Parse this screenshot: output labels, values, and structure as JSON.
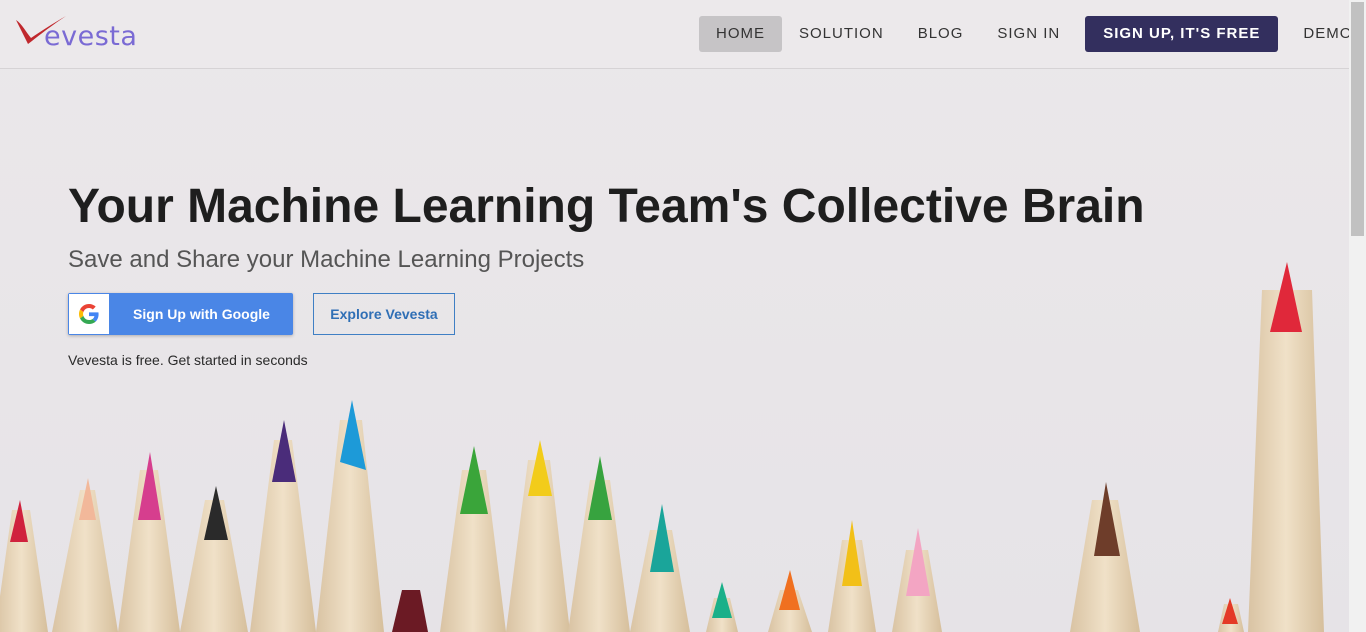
{
  "brand": {
    "logo_text": "evesta",
    "logo_mark": "V"
  },
  "nav": {
    "items": [
      "HOME",
      "SOLUTION",
      "BLOG",
      "SIGN IN",
      "SIGN UP, IT'S FREE",
      "DEMO"
    ],
    "active": "HOME"
  },
  "hero": {
    "title": "Your Machine Learning Team's Collective Brain",
    "subtitle": "Save and Share your Machine Learning Projects",
    "google_button": "Sign Up with Google",
    "explore_button": "Explore Vevesta",
    "tagline": "Vevesta is free. Get started in seconds"
  },
  "colors": {
    "cta_bg": "#332f5e",
    "google_blue": "#4a86e6",
    "explore_border": "#3f7fc4",
    "logo": "#7a6ad4",
    "logo_swoosh": "#c0282d"
  },
  "icons": {
    "google": "google-g-icon"
  }
}
